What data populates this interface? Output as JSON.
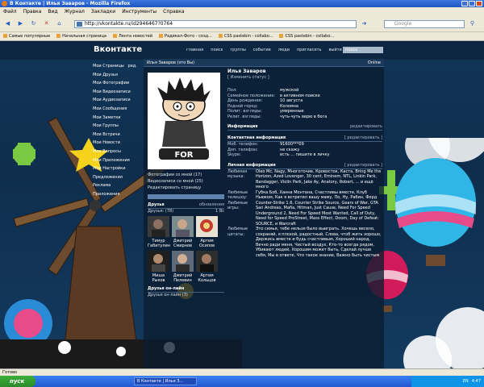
{
  "window": {
    "title": "В Контакте | Илья Заваров - Mozilla Firefox"
  },
  "menu": [
    "Файл",
    "Правка",
    "Вид",
    "Журнал",
    "Закладки",
    "Инструменты",
    "Справка"
  ],
  "navbar": {
    "url": "http://vkontakte.ru/id2946467?0764",
    "search_placeholder": "Google"
  },
  "bookmarks": [
    "Самые популярные",
    "Начальная страница",
    "Лента новостей",
    "Радикал-Фото - созд...",
    "CSS pastebin - collabo...",
    "CSS pastebin - collabo..."
  ],
  "site": {
    "logo": "Вконтакте",
    "topnav": [
      "главная",
      "поиск",
      "группы",
      "событие",
      "люди",
      "пригласить",
      "выйти"
    ],
    "search_placeholder": "поиск"
  },
  "sidebar": {
    "items": [
      "Мои Страницы",
      "ред.",
      "Мои Друзья",
      "Мои Фотографии",
      "Мои Видеозаписи",
      "Мои Аудиозаписи",
      "Мои Сообщения",
      "Мои Заметки",
      "Мои Группы",
      "Мои Встречи",
      "Мои Новости",
      "Мои Вопросы",
      "Мои Приложения",
      "Мои Настройки",
      "Предложения",
      "Реклама",
      "Приложения"
    ]
  },
  "profile": {
    "header_left": "Илья Заваров (это Вы)",
    "header_right": "Online",
    "name": "Илья Заваров",
    "status": "[ Изменить статус ]",
    "photo_caption": "FOR",
    "left_links": [
      "Фотографии со мной (17)",
      "Видеозаписи со мной (25)",
      "Редактировать страницу"
    ],
    "info": [
      {
        "k": "Пол:",
        "v": "мужской"
      },
      {
        "k": "Семейное положение:",
        "v": "в активном поиске"
      },
      {
        "k": "День рождения:",
        "v": "10 августа"
      },
      {
        "k": "Родной город:",
        "v": "Коломна"
      },
      {
        "k": "Полит. взгляды:",
        "v": "умеренные"
      },
      {
        "k": "Религ. взгляды:",
        "v": "чуть-чуть верю в бога"
      }
    ],
    "info_header": "Информация",
    "info_action": "редактировать",
    "contact_header": "Контактная информация",
    "contact_action": "[ редактировать ]",
    "contacts": [
      {
        "k": "Моб. телефон:",
        "v": "91600***09"
      },
      {
        "k": "Доп. телефон:",
        "v": "не скажу"
      },
      {
        "k": "Skype:",
        "v": "есть ... пишите в личку"
      }
    ],
    "personal_header": "Личная информация",
    "personal_action": "[ редактировать ]",
    "personal": [
      {
        "k": "Любимая музыка:",
        "v": "Oleo Mc, Nagy, Многоточие, Кровосток, Каста, Bring Me the Horizon, Azed Lovenger, 30 cent, Eminem, NTL, Linkin Park, Bandagger, Violin Park, Jake Ay, Anatory, Robert, ... и ещё много"
      },
      {
        "k": "Любимые телешоу:",
        "v": "Губка Боб, Ханна Монтана, Счастливы вместе, Клуб Ньюком, Как я встретил вашу маму, По, Ну, Рабин, Форд"
      },
      {
        "k": "Любимые игры:",
        "v": "Counter-Strike 1.6, Counter Strike Source, Gears of War, GTA San Andreas, Mafia, Hitman, Just Cause, Need For Speed Underground 2, Need For Speed Most Wanted, Call of Duty, Need for Speed ProStreet, Mass Effect, Doom, Day of Defeat: SOURCE, и Warcraft"
      },
      {
        "k": "Любимые цитаты:",
        "v": "Это семья, тебе нельзя было выиграть. Хочешь весело, сохраняй, я плохой, радостный, Слова, чтоб жить хорошо, Держись вместе и будь счастливым, Хороший народ, Вечно ради меня, Чистый воздух, Кто-то всегда рядом, Убивают людей, Хорошим может быть, Сделай лучше себя, Мы в ответе, Что такое знание, Важно быть чистым"
      }
    ],
    "friends_header": "Друзья",
    "friends_action": "обновления",
    "friends_sub_left": "Друзья: (78)",
    "friends_sub_right": "1 Вс",
    "friends": [
      "Тимур Габитулин",
      "Дмитрий Смирнов",
      "Артем Осипов",
      "Миша Рыков",
      "Дмитрий Пелевин",
      "Артем Кольцов"
    ],
    "online_header": "Друзья он-лайн",
    "online_sub": "Друзья он-лайн (3)"
  },
  "statusbar": {
    "text": "Готово"
  },
  "taskbar": {
    "start": "пуск",
    "item": "В Контакте | Илья З...",
    "lang": "EN",
    "clock": "4:47"
  }
}
